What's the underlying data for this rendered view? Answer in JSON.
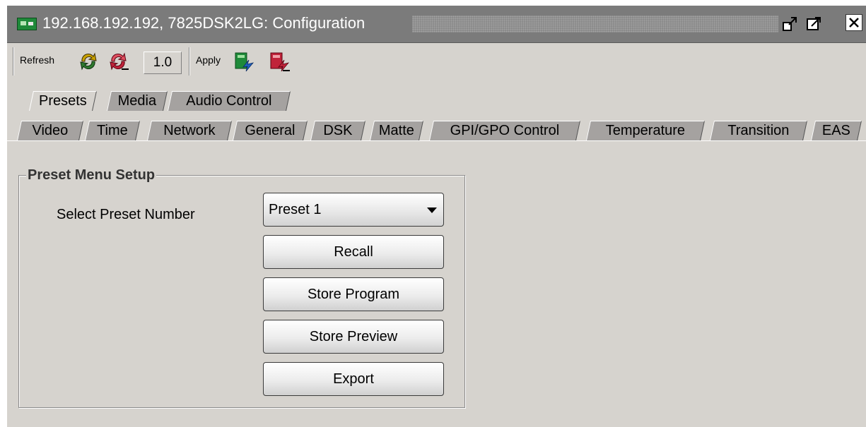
{
  "window": {
    "title": "192.168.192.192, 7825DSK2LG: Configuration"
  },
  "toolbar": {
    "refresh_label": "Refresh",
    "version_value": "1.0",
    "apply_label": "Apply"
  },
  "tabs_upper": [
    {
      "label": "Presets",
      "active": true
    },
    {
      "label": "Media",
      "active": false
    },
    {
      "label": "Audio Control",
      "active": false
    }
  ],
  "tabs_lower": [
    {
      "label": "Video"
    },
    {
      "label": "Time"
    },
    {
      "label": "Network"
    },
    {
      "label": "General"
    },
    {
      "label": "DSK"
    },
    {
      "label": "Matte"
    },
    {
      "label": "GPI/GPO Control"
    },
    {
      "label": "Temperature"
    },
    {
      "label": "Transition"
    },
    {
      "label": "EAS"
    }
  ],
  "preset_panel": {
    "legend": "Preset Menu Setup",
    "select_label": "Select Preset Number",
    "select_value": "Preset 1",
    "buttons": {
      "recall": "Recall",
      "store_program": "Store Program",
      "store_preview": "Store Preview",
      "export": "Export"
    }
  },
  "colors": {
    "window_bg": "#d6d3ce",
    "titlebar_bg": "#7b7b7b",
    "tab_inactive": "#a5a2a0",
    "icon_green": "#1f8a3a",
    "icon_red": "#c0233a"
  }
}
